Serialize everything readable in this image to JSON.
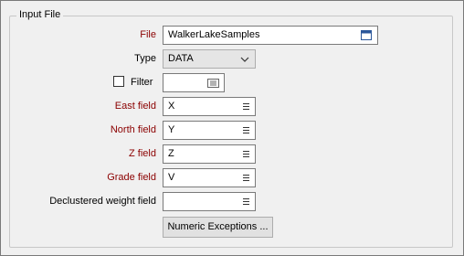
{
  "group_title": "Input File",
  "file": {
    "label": "File",
    "value": "WalkerLakeSamples"
  },
  "type": {
    "label": "Type",
    "value": "DATA"
  },
  "filter": {
    "label": "Filter",
    "checked": false,
    "value": ""
  },
  "east_field": {
    "label": "East field",
    "value": "X"
  },
  "north_field": {
    "label": "North field",
    "value": "Y"
  },
  "z_field": {
    "label": "Z field",
    "value": "Z"
  },
  "grade_field": {
    "label": "Grade field",
    "value": "V"
  },
  "declustered_weight_field": {
    "label": "Declustered weight field",
    "value": ""
  },
  "numeric_exceptions_button": "Numeric Exceptions ...",
  "colors": {
    "required_label": "#8b0000",
    "background": "#f0f0f0"
  }
}
